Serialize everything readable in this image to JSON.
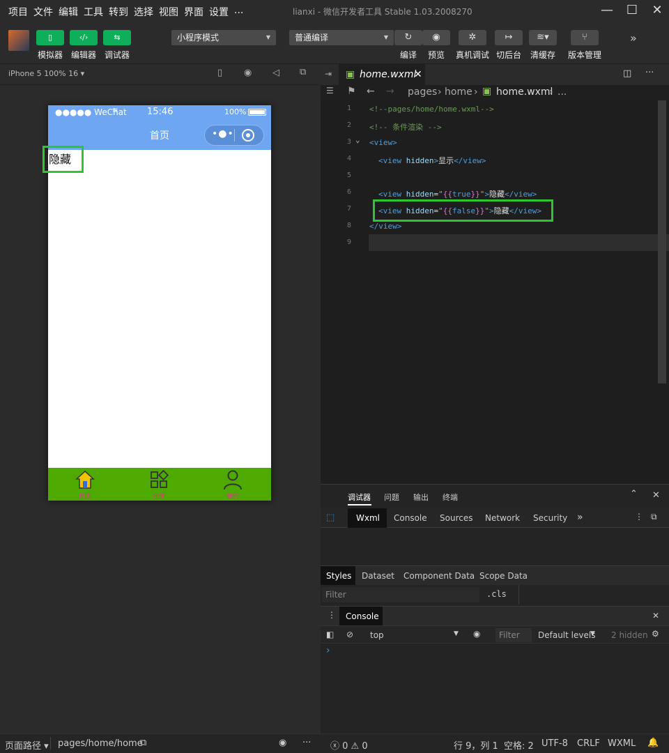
{
  "menubar": {
    "items": [
      "项目",
      "文件",
      "编辑",
      "工具",
      "转到",
      "选择",
      "视图",
      "界面",
      "设置",
      "..."
    ],
    "title": "lianxi - 微信开发者工具 Stable 1.03.2008270"
  },
  "toolbar": {
    "simulator_label": "模拟器",
    "editor_label": "编辑器",
    "debugger_label": "调试器",
    "mode_select": "小程序模式",
    "compile_select": "普通编译",
    "compile_label": "编译",
    "preview_label": "预览",
    "remote_debug_label": "真机调试",
    "background_label": "切后台",
    "clear_cache_label": "清缓存",
    "version_label": "版本管理"
  },
  "simulator": {
    "device": "iPhone 5 100% 16",
    "status": {
      "carrier": "●●●●● WeChat",
      "time": "15:46",
      "battery": "100%"
    },
    "nav_title": "首页",
    "content_text": "隐藏",
    "tabs": [
      {
        "label": "首页",
        "icon": "home-icon"
      },
      {
        "label": "分类",
        "icon": "category-icon"
      },
      {
        "label": "我的",
        "icon": "user-icon"
      }
    ]
  },
  "editor": {
    "tab_name": "home.wxml",
    "breadcrumb": [
      "pages",
      "home",
      "home.wxml",
      "..."
    ],
    "lines": [
      {
        "n": "1",
        "text": "<!--pages/home/home.wxml-->"
      },
      {
        "n": "2",
        "text": "<!-- 条件渲染 -->"
      },
      {
        "n": "3",
        "text": "<view>"
      },
      {
        "n": "4",
        "text": "<view hidden>显示</view>"
      },
      {
        "n": "5",
        "text": ""
      },
      {
        "n": "6",
        "text": "<view hidden=\"{{true}}\">隐藏</view>"
      },
      {
        "n": "7",
        "text": "<view hidden=\"{{false}}\">隐藏</view>"
      },
      {
        "n": "8",
        "text": "</view>"
      },
      {
        "n": "9",
        "text": ""
      }
    ]
  },
  "devtools": {
    "top_tabs": [
      "调试器",
      "问题",
      "输出",
      "终端"
    ],
    "panel_tabs": [
      "Wxml",
      "Console",
      "Sources",
      "Network",
      "Security"
    ],
    "style_tabs": [
      "Styles",
      "Dataset",
      "Component Data",
      "Scope Data"
    ],
    "filter_placeholder": "Filter",
    "cls_label": ".cls",
    "console_tab": "Console",
    "context": "top",
    "console_filter_placeholder": "Filter",
    "levels": "Default levels",
    "hidden_count": "2 hidden",
    "prompt": "›"
  },
  "statusbar": {
    "page_path_label": "页面路径",
    "page_path": "pages/home/home",
    "errors": "0",
    "warnings": "0",
    "cursor": "行 9，列 1",
    "spaces": "空格: 2",
    "encoding": "UTF-8",
    "eol": "CRLF",
    "language": "WXML"
  },
  "colors": {
    "accent": "#0fae5b",
    "nav": "#6ea6f2",
    "tabbar": "#4ea900",
    "highlight": "#2ec52e"
  }
}
